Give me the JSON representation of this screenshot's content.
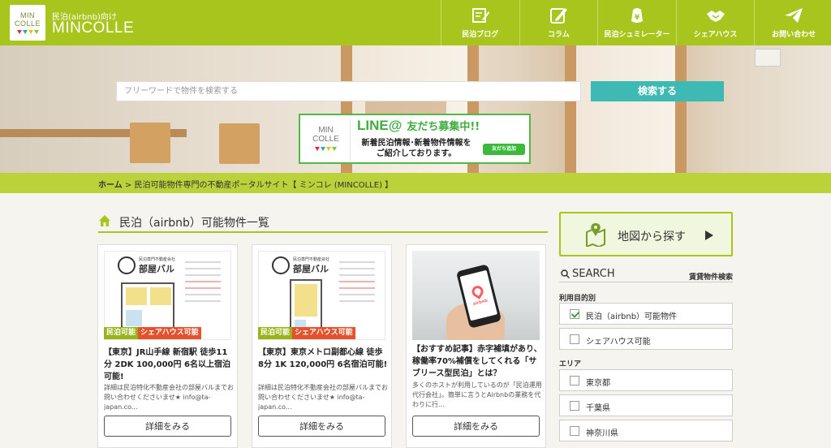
{
  "header": {
    "logo_line1": "MIN",
    "logo_line2": "COLLE",
    "tagline": "民泊(airbnb)向け",
    "site_name": "MINCOLLE",
    "nav": [
      {
        "label": "民泊ブログ",
        "icon": "blog-edit-icon"
      },
      {
        "label": "コラム",
        "icon": "pencil-note-icon"
      },
      {
        "label": "民泊シュミレーター",
        "icon": "yen-wallet-icon"
      },
      {
        "label": "シェアハウス",
        "icon": "handshake-icon"
      },
      {
        "label": "お問い合わせ",
        "icon": "paper-plane-icon"
      }
    ]
  },
  "hero": {
    "search_placeholder": "フリーワードで物件を検索する",
    "search_button": "検索する",
    "banner": {
      "logo_line1": "MIN",
      "logo_line2": "COLLE",
      "line_at": "LINE@",
      "friends": "友だち募集中!!",
      "text_line1": "新着民泊情報･新着物件情報を",
      "text_line2": "ご紹介しております。",
      "add_friend": "友だち追加"
    }
  },
  "breadcrumb": {
    "home": "ホーム",
    "current": " > 民泊可能物件専門の不動産ポータルサイト【 ミンコレ (MINCOLLE) 】"
  },
  "main": {
    "section_title": "民泊（airbnb）可能物件一覧",
    "cards": [
      {
        "flyer_company": "民泊専門不動産会社",
        "flyer_brand": "部屋バル",
        "tags": [
          "民泊可能",
          "シェアハウス可能"
        ],
        "title": "【東京】JR山手線 新宿駅 徒歩11分 2DK 100,000円 6名以上宿泊可能!",
        "description": "詳細は民泊特化不動産会社の部屋バルまでお問い合わせくださいませ★ info@ta-japan.co...",
        "button": "詳細をみる"
      },
      {
        "flyer_company": "民泊専門不動産会社",
        "flyer_brand": "部屋バル",
        "tags": [
          "民泊可能",
          "シェアハウス可能"
        ],
        "title": "【東京】東京メトロ副都心線 徒歩8分 1K 120,000円 6名宿泊可能!",
        "description": "詳細は民泊特化不動産会社の部屋バルまでお問い合わせくださいませ★ info@ta-japan.co...",
        "button": "詳細をみる"
      },
      {
        "screen_label": "airbnb",
        "title": "【おすすめ記事】赤字補填があり、稼働率70%補償をしてくれる「サブリース型民泊」とは？",
        "description": "多くのホストが利用しているのが「民泊運用代行会社」。簡単に言うとAirbnbの業務を代わりに行...",
        "button": "詳細をみる"
      }
    ]
  },
  "sidebar": {
    "map_label": "地図から探す",
    "search_title": "SEARCH",
    "search_link": "賃貸物件検索",
    "purpose_heading": "利用目的別",
    "purpose_options": [
      {
        "label": "民泊（airbnb）可能物件",
        "checked": true
      },
      {
        "label": "シェアハウス可能",
        "checked": false
      }
    ],
    "area_heading": "エリア",
    "area_options": [
      {
        "label": "東京都",
        "checked": false
      },
      {
        "label": "千葉県",
        "checked": false
      },
      {
        "label": "神奈川県",
        "checked": false
      }
    ]
  },
  "colors": {
    "brand_green": "#a8c51d",
    "teal": "#3fb9b3",
    "tag_green": "#98b41a",
    "tag_red": "#e4512c"
  }
}
